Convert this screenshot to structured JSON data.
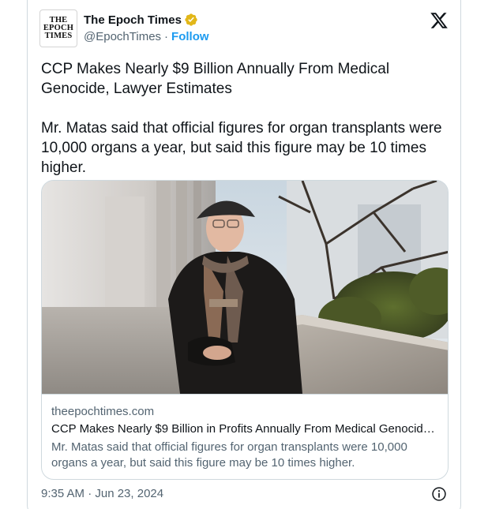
{
  "author": {
    "display_name": "The Epoch Times",
    "handle": "@EpochTimes",
    "separator": "·",
    "follow_label": "Follow",
    "avatar_lines": [
      "THE",
      "EPOCH",
      "TIMES"
    ]
  },
  "tweet": {
    "title": "CCP Makes Nearly $9 Billion Annually From Medical Genocide, Lawyer Estimates",
    "body": "Mr. Matas said that official figures for organ transplants were 10,000 organs a year, but said this figure may be 10 times higher."
  },
  "link_card": {
    "domain": "theepochtimes.com",
    "headline": "CCP Makes Nearly $9 Billion in Profits Annually From Medical Genocide, ...",
    "description": "Mr. Matas said that official figures for organ transplants were 10,000 organs a year, but said this figure may be 10 times higher."
  },
  "timestamp": "9:35 AM · Jun 23, 2024",
  "icons": {
    "verified": "verified-badge-icon",
    "platform": "x-logo-icon",
    "info": "info-icon"
  },
  "colors": {
    "accent": "#1d9bf0",
    "verified_gold": "#e2b719",
    "text_primary": "#0f1419",
    "text_secondary": "#536471",
    "border": "#cfd9de"
  }
}
